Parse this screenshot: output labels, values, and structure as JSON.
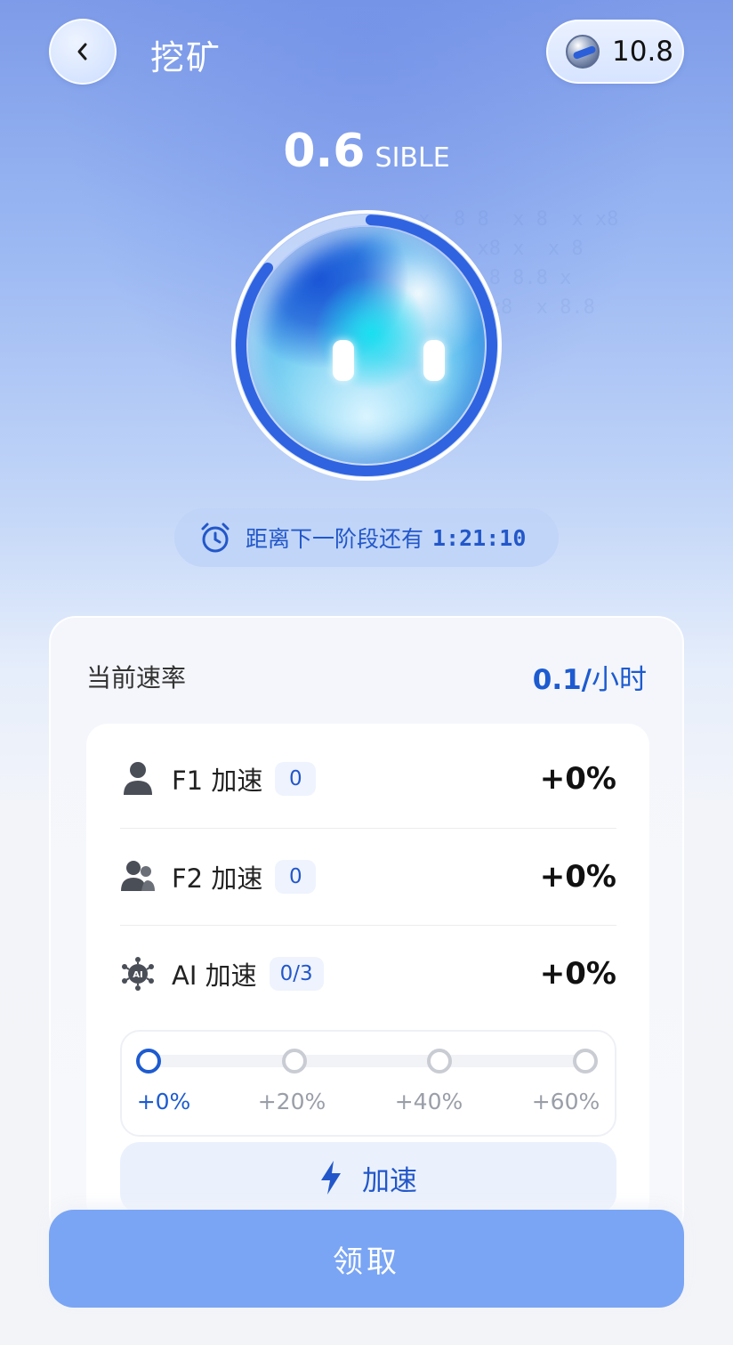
{
  "header": {
    "title": "挖矿",
    "back_icon": "chevron-left-icon",
    "balance": "10.8",
    "coin_icon": "coin-icon"
  },
  "mining": {
    "amount": "0.6",
    "unit": "SIBLE",
    "progress": 0.85
  },
  "timer": {
    "icon": "alarm-clock-icon",
    "label": "距离下一阶段还有",
    "value": "1:21:10"
  },
  "rate": {
    "label": "当前速率",
    "value": "0.1/",
    "per": "小时"
  },
  "boosts": [
    {
      "icon": "person-icon",
      "label": "F1 加速",
      "badge": "0",
      "percent": "+0%"
    },
    {
      "icon": "people-icon",
      "label": "F2 加速",
      "badge": "0",
      "percent": "+0%"
    },
    {
      "icon": "ai-chip-icon",
      "label": "AI 加速",
      "badge": "0/3",
      "percent": "+0%"
    }
  ],
  "ai_levels": {
    "current_index": 0,
    "labels": [
      "+0%",
      "+20%",
      "+40%",
      "+60%"
    ]
  },
  "accelerate_button": {
    "icon": "lightning-icon",
    "label": "加速"
  },
  "claim_button": {
    "label": "领取"
  },
  "colors": {
    "accent": "#1d5bd0",
    "claim_button": "#7aa5f4",
    "header_gradient_top": "#7d9be8"
  }
}
